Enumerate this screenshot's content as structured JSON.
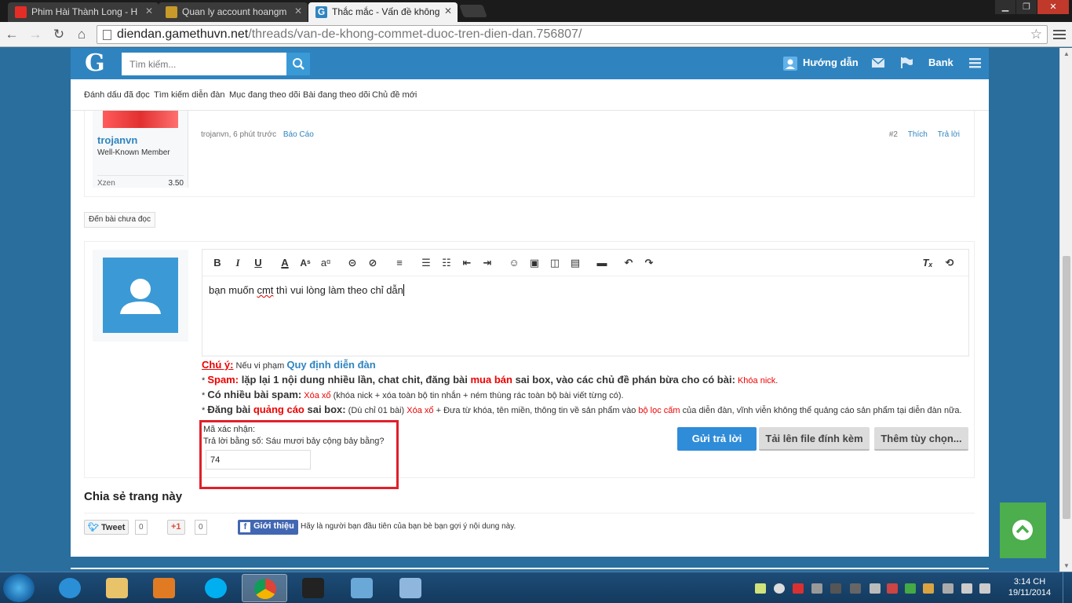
{
  "browser": {
    "tabs": [
      {
        "title": "Phim Hài Thành Long - H",
        "active": false
      },
      {
        "title": "Quan ly account hoangm",
        "active": false
      },
      {
        "title": "Thắc mắc - Vấn đề không",
        "active": true
      }
    ],
    "url_domain": "diendan.gamethuvn.net",
    "url_path": "/threads/van-de-khong-commet-duoc-tren-dien-dan.756807/"
  },
  "site": {
    "logo": "G",
    "search_placeholder": "Tìm kiếm...",
    "header_links": {
      "guide": "Hướng dẫn",
      "bank": "Bank"
    },
    "subnav": [
      "Đánh dấu đã đọc",
      "Tìm kiếm diễn đàn",
      "Mục đang theo dõi",
      "Bài đang theo dõi",
      "Chủ đề mới"
    ]
  },
  "post": {
    "username": "trojanvn",
    "user_title": "Well-Known Member",
    "stat_label": "Xzen",
    "stat_value": "3.50",
    "meta": "trojanvn, 6 phút trước",
    "report": "Báo Cáo",
    "number": "#2",
    "like": "Thích",
    "reply": "Trả lời"
  },
  "unread_button": "Đến bài chưa đọc",
  "editor": {
    "text_pre": "bạn muốn ",
    "text_misspelled": "cmt",
    "text_post": " thì vui lòng làm theo chỉ dẫn"
  },
  "rules": {
    "note_label": "Chú ý:",
    "note_text": " Nếu vi phạm ",
    "note_link": "Quy định diễn đàn",
    "l1_a": "Spam:",
    "l1_b": " lặp lại 1 nội dung nhiều lần, chat chit, đăng bài ",
    "l1_c": "mua bán",
    "l1_d": " sai box, vào các chủ đề phán bừa cho có bài:",
    "l1_e": " Khóa nick",
    "l1_f": ".",
    "l2_a": "Có nhiều bài spam:",
    "l2_b": " Xóa xổ",
    "l2_c": " (khóa nick + xóa toàn bộ tin nhắn + ném thùng rác toàn bộ bài viết từng có).",
    "l3_a": "Đăng bài ",
    "l3_b": "quảng cáo",
    "l3_c": " sai box:",
    "l3_d": " (Dù chỉ 01 bài) ",
    "l3_e": "Xóa xổ",
    "l3_f": " + Đưa từ khóa, tên miền, thông tin về sản phẩm vào ",
    "l3_g": "bộ lọc cấm",
    "l3_h": " của diễn đàn, vĩnh viễn không thể quảng cáo sản phẩm tại diễn đàn nữa."
  },
  "captcha": {
    "label": "Mã xác nhận:",
    "question": "Trả lời bằng số: Sáu mươi bảy cộng bảy bằng?",
    "value": "74"
  },
  "buttons": {
    "submit": "Gửi trả lời",
    "upload": "Tải lên file đính kèm",
    "more": "Thêm tùy chọn..."
  },
  "share": {
    "title": "Chia sẻ trang này",
    "tweet": "Tweet",
    "tweet_count": "0",
    "gplus": "+1",
    "gplus_count": "0",
    "fb": "Giới thiệu",
    "fb_text": "Hãy là người bạn đầu tiên của bạn bè bạn gợi ý nội dung này."
  },
  "taskbar": {
    "time": "3:14 CH",
    "date": "19/11/2014"
  },
  "colors": {
    "brand": "#2f84c0",
    "page_bg": "#2a6e9e",
    "highlight": "#e0202a",
    "back_to_top": "#4cae4c"
  }
}
